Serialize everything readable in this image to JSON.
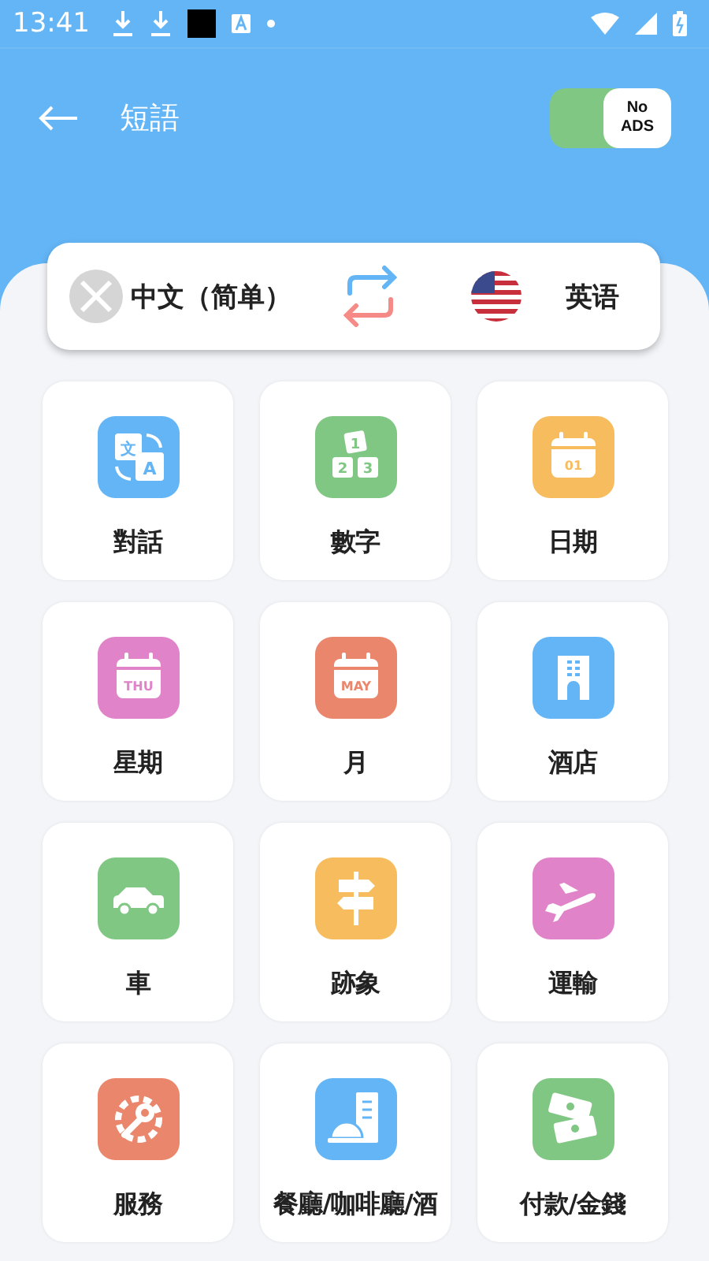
{
  "status_bar": {
    "time": "13:41"
  },
  "header": {
    "title": "短語",
    "ads_toggle": {
      "label_top": "No",
      "label_bottom": "ADS",
      "on": true
    }
  },
  "language_bar": {
    "source": "中文（简单）",
    "target": "英语"
  },
  "categories": [
    {
      "label": "對話",
      "kind": "translate",
      "color": "#64b5f6",
      "icon_text": [
        "文",
        "A"
      ]
    },
    {
      "label": "數字",
      "kind": "numbers",
      "color": "#81c784",
      "icon_text": [
        "1",
        "2",
        "3"
      ]
    },
    {
      "label": "日期",
      "kind": "calendar",
      "color": "#f6bc5e",
      "icon_text": [
        "01"
      ]
    },
    {
      "label": "星期",
      "kind": "calendar",
      "color": "#e083c8",
      "icon_text": [
        "THU"
      ]
    },
    {
      "label": "月",
      "kind": "calendar",
      "color": "#ea866c",
      "icon_text": [
        "MAY"
      ]
    },
    {
      "label": "酒店",
      "kind": "building",
      "color": "#64b5f6"
    },
    {
      "label": "車",
      "kind": "car",
      "color": "#81c784"
    },
    {
      "label": "跡象",
      "kind": "signpost",
      "color": "#f6bc5e"
    },
    {
      "label": "運輸",
      "kind": "plane",
      "color": "#e083c8"
    },
    {
      "label": "服務",
      "kind": "service",
      "color": "#ea866c"
    },
    {
      "label": "餐廳/咖啡廳/酒",
      "kind": "restaurant",
      "color": "#64b5f6"
    },
    {
      "label": "付款/金錢",
      "kind": "money",
      "color": "#81c784"
    }
  ]
}
